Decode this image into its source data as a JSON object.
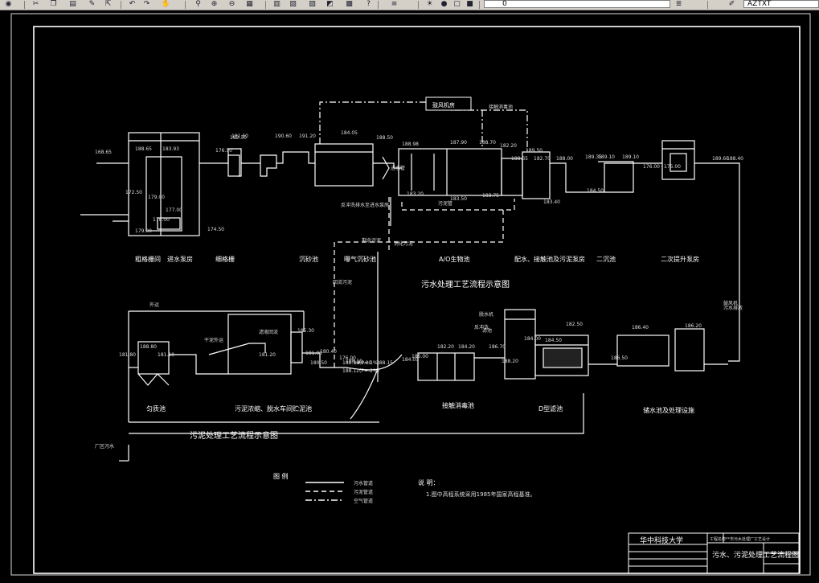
{
  "toolbar": {
    "layer_value": "0",
    "text_style_value": "AZTXT",
    "icons": [
      "globe-icon",
      "cut-icon",
      "copy-icon",
      "paste-icon",
      "brush-icon",
      "match-icon",
      "undo-icon",
      "redo-icon",
      "pan-icon",
      "zoom-realtime-icon",
      "zoom-window-icon",
      "zoom-previous-icon",
      "properties-icon",
      "design-center-icon",
      "tool-palette-icon",
      "sheet-set-icon",
      "markup-icon",
      "calculator-icon",
      "help-icon",
      "layers-icon",
      "bulb-icon",
      "sun-icon",
      "lock-icon",
      "color-icon",
      "layer-states-icon",
      "plot-style-icon"
    ]
  },
  "drawing": {
    "main_title": "污水处理工艺流程示意图",
    "sludge_title": "污泥处理工艺流程示意图",
    "water_units": [
      {
        "label": "粗格栅间"
      },
      {
        "label": "进水泵房"
      },
      {
        "label": "细格栅"
      },
      {
        "label": "曝气沉砂池"
      },
      {
        "label": "沉砂池"
      },
      {
        "label": "A/O生物池"
      },
      {
        "label": "二沉池"
      },
      {
        "label": "配水、接触池及污泥泵房"
      },
      {
        "label": "二次提升泵房"
      }
    ],
    "sludge_units": [
      {
        "label": "贮泥池"
      },
      {
        "label": "污泥浓缩、脱水车间"
      },
      {
        "label": "匀质池"
      },
      {
        "label": "接触消毒池"
      },
      {
        "label": "D型滤池"
      },
      {
        "label": "储水池及处理设施"
      }
    ],
    "elevations_top": [
      "168.65",
      "188.65",
      "183.93",
      "181.60",
      "176.50",
      "172.50",
      "174.50",
      "179.00",
      "179.00",
      "177.00",
      "178.00",
      "182.30",
      "190.60",
      "191.20",
      "184.05",
      "188.50",
      "188.98",
      "187.90",
      "188.70",
      "183.20",
      "183.50",
      "183.75",
      "182.20",
      "188.65",
      "189.50",
      "182.70",
      "183.40",
      "188.00",
      "189.35",
      "189.10",
      "184.50",
      "189.10",
      "176.00",
      "175.00",
      "189.60",
      "188.40"
    ],
    "elevations_bottom": [
      "181.80",
      "188.80",
      "181.10",
      "181.20",
      "185.30",
      "181.00",
      "180.50",
      "180.40",
      "186.00",
      "176.00",
      "188.15",
      "184.05",
      "182.20",
      "184.20",
      "186.70",
      "188.20",
      "184.00",
      "184.50",
      "182.50",
      "186.50",
      "186.40",
      "186.20"
    ],
    "notes_top": [
      "鼓风机房",
      "接触消毒池",
      "反冲洗排水至进水泵房",
      "1#0.00",
      "188.10",
      "进水管"
    ],
    "notes_mid": [
      "剩余污泥",
      "回流污泥",
      "消化污泥"
    ],
    "notes_bottom": [
      "外运",
      "干泥外运",
      "滤液回流",
      "厂区污水",
      "脱水机",
      "鼓风机",
      "滤池",
      "188.10(P=-1%)",
      "188.12(P=-2%)",
      "污水排放",
      "污泥管",
      "反冲洗"
    ],
    "legend": {
      "title": "图  例",
      "items": [
        {
          "label": "污水管道"
        },
        {
          "label": "污泥管道"
        },
        {
          "label": "空气管道"
        }
      ]
    },
    "notes": {
      "title": "说  明：",
      "items": [
        "1.图中高程系统采用1985年国家高程基准。"
      ]
    },
    "title_block": {
      "school": "华中科技大学",
      "drawing_name": "污水、污泥处理工艺流程图",
      "project": "工程名称",
      "project_value": "**市污水处理厂工艺设计"
    }
  }
}
